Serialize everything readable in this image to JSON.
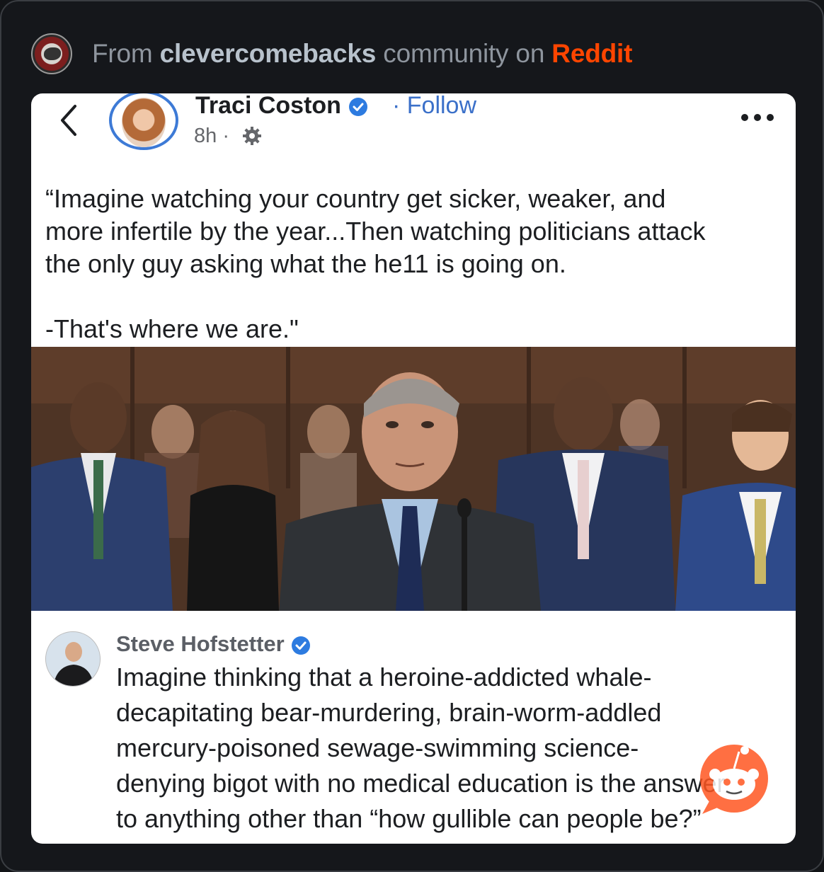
{
  "header": {
    "prefix": "From",
    "community": "clevercomebacks",
    "middle": "community on",
    "platform": "Reddit",
    "platform_color": "#ff4500"
  },
  "post": {
    "author": "Traci Coston",
    "follow_label": "· Follow",
    "time": "8h ·",
    "text_lines": [
      "“Imagine watching your country get sicker, weaker, and",
      "more infertile by the year...Then watching politicians attack",
      "the only guy asking what the he11 is going on.",
      "",
      "-That's where we are.\""
    ],
    "icons": {
      "back": "chevron-left-icon",
      "verified": "verified-badge-icon",
      "audience": "gear-icon",
      "more": "more-dots-icon"
    }
  },
  "comment": {
    "author": "Steve Hofstetter",
    "text_lines": [
      "Imagine thinking that a heroine-addicted whale-",
      "decapitating bear-murdering, brain-worm-addled",
      "mercury-poisoned sewage-swimming science-",
      "denying bigot with no medical education is the answer",
      "to anything other than “how gullible can people be?”"
    ]
  },
  "colors": {
    "background": "#15171b",
    "card": "#ffffff",
    "verified": "#2d7be0",
    "follow": "#3b70c9"
  }
}
